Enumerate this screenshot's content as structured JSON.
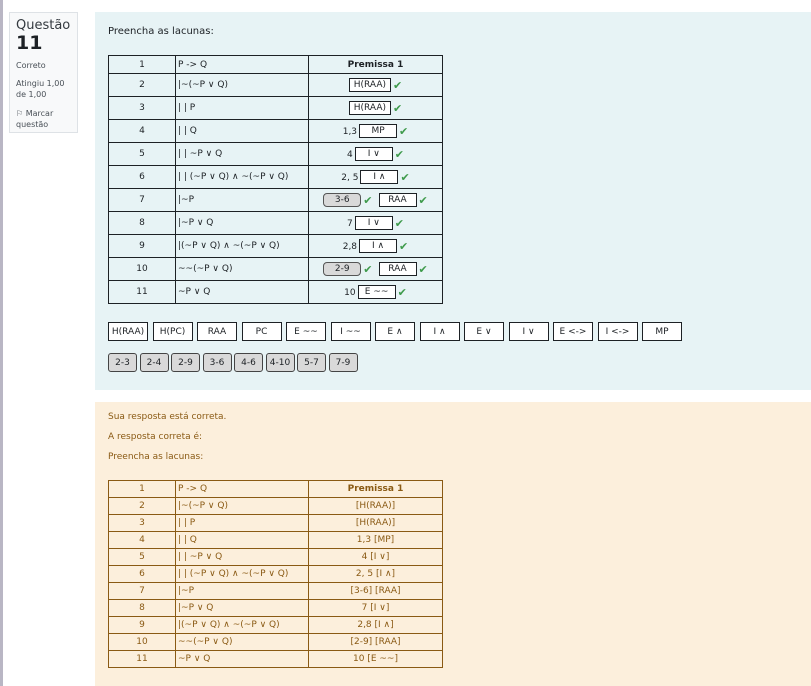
{
  "question": {
    "label": "Questão",
    "number": "11",
    "state": "Correto",
    "grade": "Atingiu 1,00 de 1,00",
    "flag_label": "Marcar questão"
  },
  "formulation": {
    "instruction": "Preencha as lacunas:",
    "header_row": {
      "num": "1",
      "formula": "P -> Q",
      "justification": "Premissa 1"
    },
    "rows": [
      {
        "num": "2",
        "formula": "|~(~P ∨ Q)",
        "drops": [
          "H(RAA)"
        ]
      },
      {
        "num": "3",
        "formula": "| | P",
        "drops": [
          "H(RAA)"
        ]
      },
      {
        "num": "4",
        "formula": "| | Q",
        "prefix": "1,3",
        "drops": [
          "MP"
        ]
      },
      {
        "num": "5",
        "formula": "| | ~P ∨ Q",
        "prefix": "4",
        "drops": [
          "I ∨"
        ]
      },
      {
        "num": "6",
        "formula": "| | (~P ∨ Q) ∧ ~(~P ∨ Q)",
        "prefix": "2, 5",
        "drops": [
          "I ∧"
        ]
      },
      {
        "num": "7",
        "formula": "|~P",
        "range": "3-6",
        "drops": [
          "RAA"
        ]
      },
      {
        "num": "8",
        "formula": "|~P ∨ Q",
        "prefix": "7",
        "drops": [
          "I ∨"
        ]
      },
      {
        "num": "9",
        "formula": "|(~P ∨ Q) ∧ ~(~P ∨ Q)",
        "prefix": "2,8",
        "drops": [
          "I ∧"
        ]
      },
      {
        "num": "10",
        "formula": "~~(~P ∨ Q)",
        "range": "2-9",
        "drops": [
          "RAA"
        ]
      },
      {
        "num": "11",
        "formula": "~P ∨ Q",
        "prefix": "10",
        "drops": [
          "E ~~"
        ]
      }
    ],
    "rule_tokens": [
      "H(RAA)",
      "H(PC)",
      "RAA",
      "PC",
      "E ~~",
      "I ~~",
      "E ∧",
      "I ∧",
      "E ∨",
      "I ∨",
      "E <->",
      "I <->",
      "MP"
    ],
    "range_tokens": [
      "2-3",
      "2-4",
      "2-9",
      "3-6",
      "4-6",
      "4-10",
      "5-7",
      "7-9"
    ]
  },
  "feedback": {
    "line1": "Sua resposta está correta.",
    "line2": "A resposta correta é:",
    "line3": "Preencha as lacunas:",
    "rows": [
      {
        "num": "1",
        "formula": "P -> Q",
        "justification": "Premissa 1"
      },
      {
        "num": "2",
        "formula": "|~(~P ∨ Q)",
        "justification": "[H(RAA)]"
      },
      {
        "num": "3",
        "formula": "| | P",
        "justification": "[H(RAA)]"
      },
      {
        "num": "4",
        "formula": "| | Q",
        "justification": "1,3 [MP]"
      },
      {
        "num": "5",
        "formula": "| | ~P ∨ Q",
        "justification": "4 [I ∨]"
      },
      {
        "num": "6",
        "formula": "| | (~P ∨ Q) ∧ ~(~P ∨ Q)",
        "justification": "2, 5 [I ∧]"
      },
      {
        "num": "7",
        "formula": "|~P",
        "justification": "[3-6] [RAA]"
      },
      {
        "num": "8",
        "formula": "|~P ∨ Q",
        "justification": "7 [I ∨]"
      },
      {
        "num": "9",
        "formula": "|(~P ∨ Q) ∧ ~(~P ∨ Q)",
        "justification": "2,8 [I ∧]"
      },
      {
        "num": "10",
        "formula": "~~(~P ∨ Q)",
        "justification": "[2-9] [RAA]"
      },
      {
        "num": "11",
        "formula": "~P ∨ Q",
        "justification": "10 [E ~~]"
      }
    ]
  },
  "colors": {
    "formulation_bg": "#e7f3f5",
    "feedback_bg": "#fcefdc",
    "feedback_text": "#8a5a14",
    "correct_tick": "#3e9a4b"
  },
  "icons": {
    "correct": "check-icon",
    "flag": "flag-icon"
  }
}
